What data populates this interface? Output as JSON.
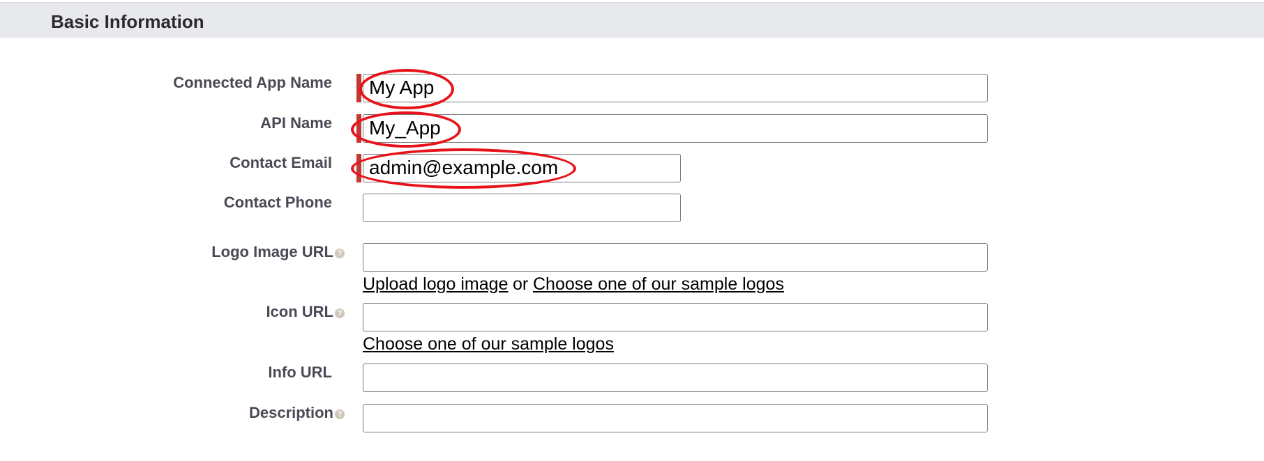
{
  "section": {
    "title": "Basic Information"
  },
  "fields": {
    "app_name": {
      "label": "Connected App Name",
      "value": "My App",
      "required": true
    },
    "api_name": {
      "label": "API Name",
      "value": "My_App",
      "required": true
    },
    "email": {
      "label": "Contact Email",
      "value": "admin@example.com",
      "required": true
    },
    "phone": {
      "label": "Contact Phone",
      "value": ""
    },
    "logo_url": {
      "label": "Logo Image URL",
      "value": "",
      "help": "?"
    },
    "icon_url": {
      "label": "Icon URL",
      "value": "",
      "help": "?"
    },
    "info_url": {
      "label": "Info URL",
      "value": ""
    },
    "description": {
      "label": "Description",
      "value": "",
      "help": "?"
    }
  },
  "logo_links": {
    "upload": "Upload logo image",
    "or": "or",
    "choose": "Choose one of our sample logos"
  },
  "icon_links": {
    "choose": "Choose one of our sample logos"
  },
  "colors": {
    "required_bar": "#c23934",
    "annotation": "#e8131a",
    "header_bg": "#e8e9ec"
  }
}
